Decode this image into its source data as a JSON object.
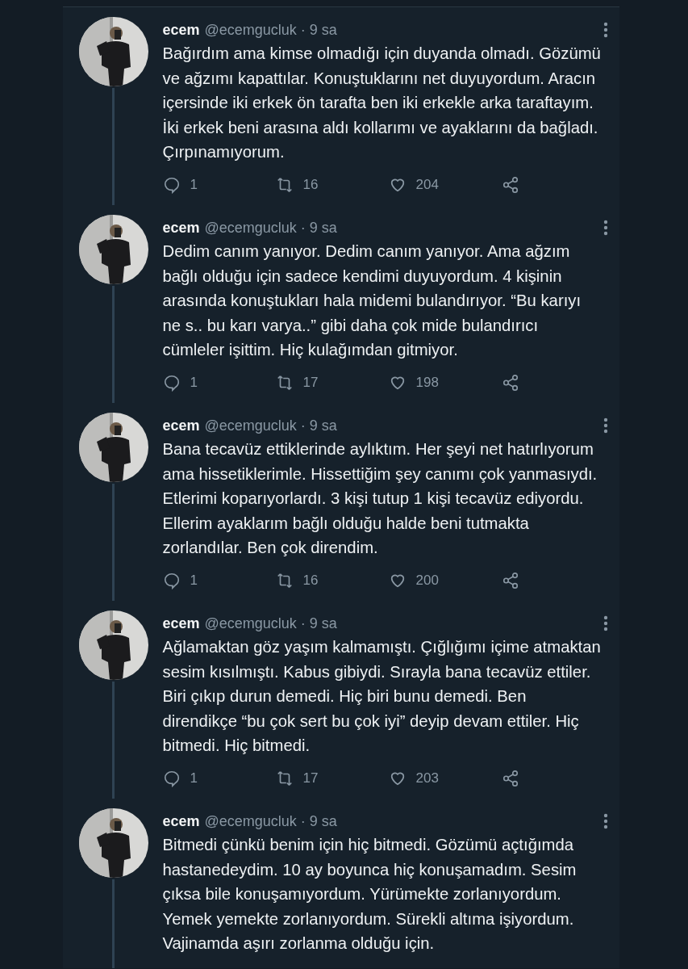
{
  "tweets": [
    {
      "name": "ecem",
      "meta": "@ecemgucluk · 9 sa",
      "text": "Bağırdım ama kimse olmadığı için duyanda olmadı. Gözümü ve ağzımı kapattılar. Konuştuklarını net duyuyordum. Aracın içersinde iki erkek ön tarafta ben iki erkekle arka taraftayım. İki erkek beni arasına aldı kollarımı ve ayaklarını da bağladı. Çırpınamıyorum.",
      "replies": "1",
      "retweets": "16",
      "likes": "204"
    },
    {
      "name": "ecem",
      "meta": "@ecemgucluk · 9 sa",
      "text": "Dedim canım yanıyor. Dedim canım yanıyor. Ama ağzım bağlı olduğu için sadece kendimi duyuyordum. 4 kişinin arasında konuştukları hala midemi bulandırıyor. “Bu karıyı ne s.. bu karı varya..” gibi daha çok mide bulandırıcı cümleler işittim. Hiç kulağımdan gitmiyor.",
      "replies": "1",
      "retweets": "17",
      "likes": "198"
    },
    {
      "name": "ecem",
      "meta": "@ecemgucluk · 9 sa",
      "text": "Bana tecavüz ettiklerinde aylıktım. Her şeyi net hatırlıyorum ama hissetiklerimle. Hissettiğim şey canımı çok yanmasıydı. Etlerimi koparıyorlardı. 3 kişi tutup 1 kişi tecavüz ediyordu. Ellerim ayaklarım bağlı olduğu halde beni tutmakta zorlandılar. Ben çok direndim.",
      "replies": "1",
      "retweets": "16",
      "likes": "200"
    },
    {
      "name": "ecem",
      "meta": "@ecemgucluk · 9 sa",
      "text": "Ağlamaktan göz yaşım kalmamıştı. Çığlığımı içime atmaktan sesim kısılmıştı. Kabus gibiydi. Sırayla bana tecavüz ettiler. Biri çıkıp durun demedi. Hiç biri bunu demedi. Ben direndikçe “bu çok sert bu çok iyi” deyip devam ettiler. Hiç bitmedi. Hiç bitmedi.",
      "replies": "1",
      "retweets": "17",
      "likes": "203"
    },
    {
      "name": "ecem",
      "meta": "@ecemgucluk · 9 sa",
      "text": "Bitmedi çünkü benim için hiç bitmedi. Gözümü açtığımda hastanedeydim. 10 ay boyunca hiç konuşamadım. Sesim çıksa bile konuşamıyordum. Yürümekte zorlanıyordum. Yemek yemekte zorlanıyordum. Sürekli altıma işiyordum. Vajinamda aşırı zorlanma olduğu için."
    }
  ]
}
